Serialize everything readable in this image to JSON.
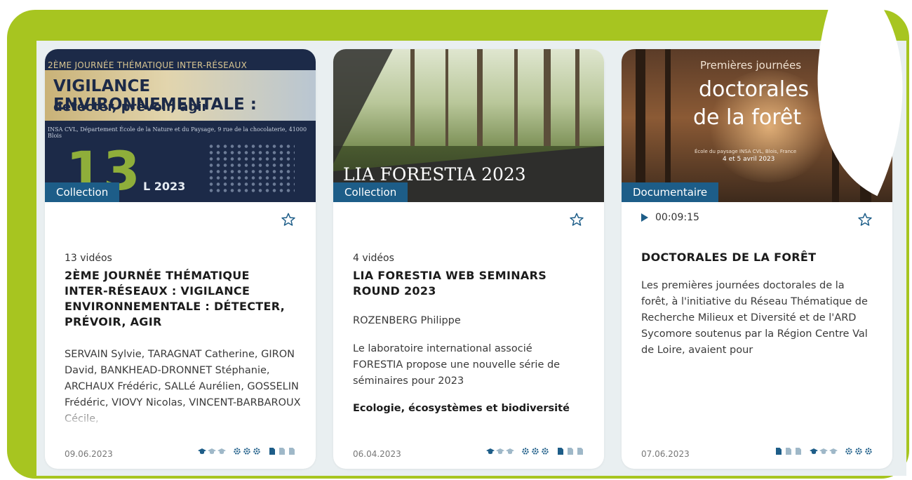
{
  "cards": [
    {
      "badge": "Collection",
      "thumb": {
        "line1": "2ÈME JOURNÉE THÉMATIQUE INTER-RÉSEAUX",
        "line2": "VIGILANCE ENVIRONNEMENTALE :",
        "line3": "détecter, prévoir, agir",
        "address": "INSA CVL, Département École de la Nature et du Paysage, 9 rue de la chocolaterie, 41000 Blois",
        "day": "13",
        "year": "L 2023"
      },
      "count": "13 vidéos",
      "title": "2ÈME JOURNÉE THÉMATIQUE INTER-RÉSEAUX : VIGILANCE ENVIRONNEMENTALE : DÉTECTER, PRÉVOIR, AGIR",
      "authors": "SERVAIN Sylvie, TARAGNAT Catherine, GIRON David, BANKHEAD-DRONNET Stéphanie, ARCHAUX Frédéric, SALLé Aurélien, GOSSELIN Frédéric, VIOVY Nicolas, VINCENT-BARBAROUX Cécile,",
      "date": "09.06.2023"
    },
    {
      "badge": "Collection",
      "thumb": {
        "title": "LIA FORESTIA 2023"
      },
      "count": "4 vidéos",
      "title": "LIA FORESTIA WEB SEMINARS ROUND 2023",
      "author": "ROZENBERG Philippe",
      "description": "Le laboratoire international associé FORESTIA propose une nouvelle série de séminaires pour 2023",
      "tag": "Ecologie, écosystèmes et biodiversité",
      "date": "06.04.2023"
    },
    {
      "badge": "Documentaire",
      "thumb": {
        "line1": "Premières journées",
        "line2": "doctorales",
        "line3": "de la forêt",
        "line4": "École du paysage INSA CVL, Blois, France",
        "line5": "4 et 5 avril 2023"
      },
      "duration": "00:09:15",
      "title": "DOCTORALES DE LA FORÊT",
      "description": "Les premières journées doctorales de la forêt, à l'initiative du Réseau Thématique de Recherche Milieux et Diversité et de l'ARD Sycomore soutenus par la Région Centre Val de Loire, avaient pour",
      "date": "07.06.2023"
    }
  ],
  "colors": {
    "frame": "#a7c520",
    "badge": "#1d5d88",
    "icon_active": "#1d5d88",
    "icon_inactive": "#9fb8c8"
  },
  "icons": [
    "star-icon",
    "play-icon",
    "graduation-cap-icon",
    "gear-icon",
    "document-icon"
  ]
}
